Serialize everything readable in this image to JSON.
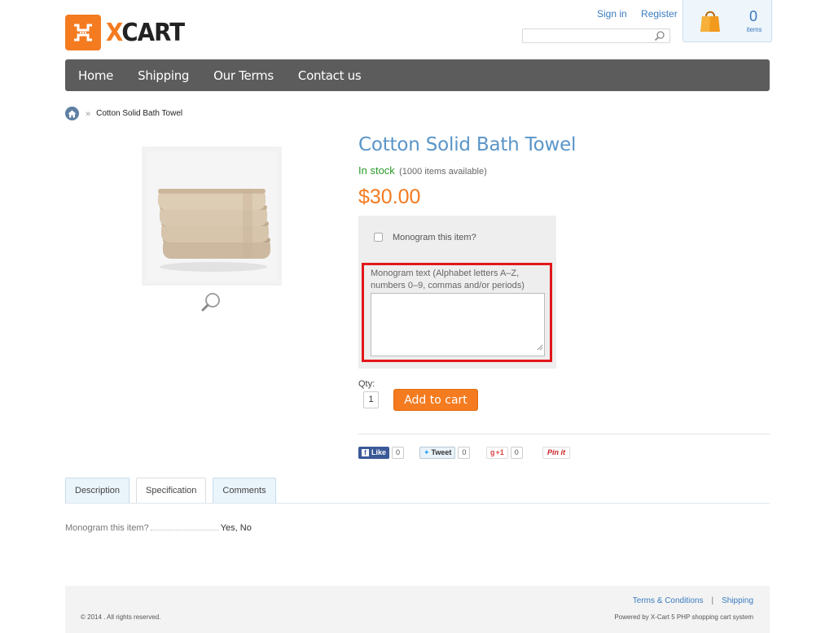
{
  "header": {
    "logo_text_x": "X",
    "logo_text_rest": "CART",
    "sign_in": "Sign in",
    "register": "Register",
    "cart_count": "0",
    "cart_items_label": "items"
  },
  "nav": {
    "items": [
      "Home",
      "Shipping",
      "Our Terms",
      "Contact us"
    ]
  },
  "breadcrumb": {
    "separator": "»",
    "current": "Cotton Solid Bath Towel"
  },
  "product": {
    "title": "Cotton Solid Bath Towel",
    "stock_status": "In stock",
    "stock_available": "(1000 items available)",
    "price": "$30.00",
    "monogram_checkbox_label": "Monogram this item?",
    "monogram_checked": false,
    "monogram_text_label": "Monogram text (Alphabet letters A–Z, numbers 0–9, commas and/or periods)",
    "monogram_text_value": "",
    "qty_label": "Qty:",
    "qty_value": "1",
    "add_to_cart": "Add to cart"
  },
  "social": {
    "like_label": "Like",
    "like_count": "0",
    "tweet_label": "Tweet",
    "tweet_count": "0",
    "gplus_label": "+1",
    "gplus_count": "0",
    "pinit_label": "Pin it"
  },
  "tabs": {
    "items": [
      "Description",
      "Specification",
      "Comments"
    ],
    "active": "Specification"
  },
  "specification": {
    "name": "Monogram this item?",
    "value": "Yes, No"
  },
  "footer": {
    "copyright": "© 2014 . All rights reserved.",
    "link_terms": "Terms & Conditions",
    "link_separator": "|",
    "link_shipping": "Shipping",
    "powered_by": "Powered by X-Cart 5 PHP shopping cart system"
  },
  "colors": {
    "accent_orange": "#f47b20",
    "link_blue": "#3a7bbf",
    "nav_bg": "#5c5c5c",
    "in_stock_green": "#2a9a2a",
    "highlight_red": "#e3161b"
  }
}
